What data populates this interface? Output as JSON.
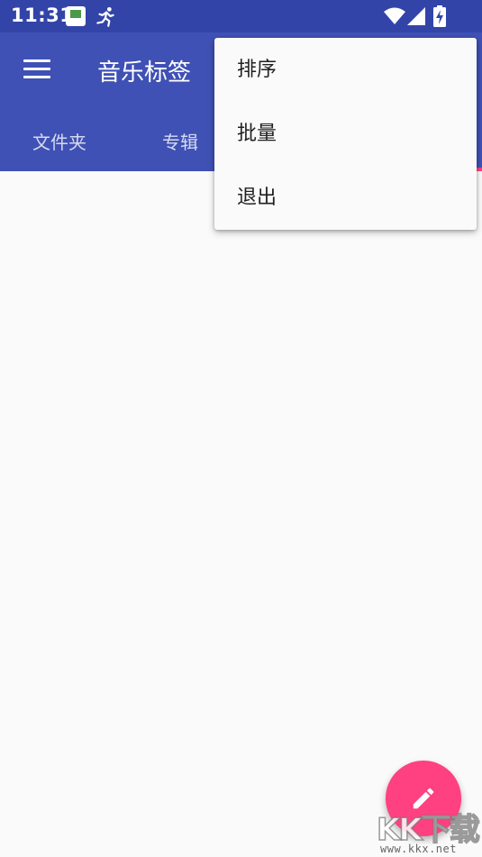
{
  "status_bar": {
    "time": "11:31",
    "icons": [
      "app-notification-icon",
      "running-icon",
      "wifi-icon",
      "cell-signal-icon",
      "battery-charging-icon"
    ]
  },
  "app_bar": {
    "title": "音乐标签",
    "background": "#3f51b5",
    "tabs": [
      {
        "label": "文件夹"
      },
      {
        "label": "专辑"
      }
    ],
    "indicator_color": "#ff4081"
  },
  "overflow_menu": {
    "items": [
      {
        "label": "排序"
      },
      {
        "label": "批量"
      },
      {
        "label": "退出"
      }
    ]
  },
  "fab": {
    "icon": "edit-pencil-icon",
    "color": "#ff4081"
  },
  "watermark": {
    "text": "KK下载",
    "url": "www.kkx.net"
  }
}
